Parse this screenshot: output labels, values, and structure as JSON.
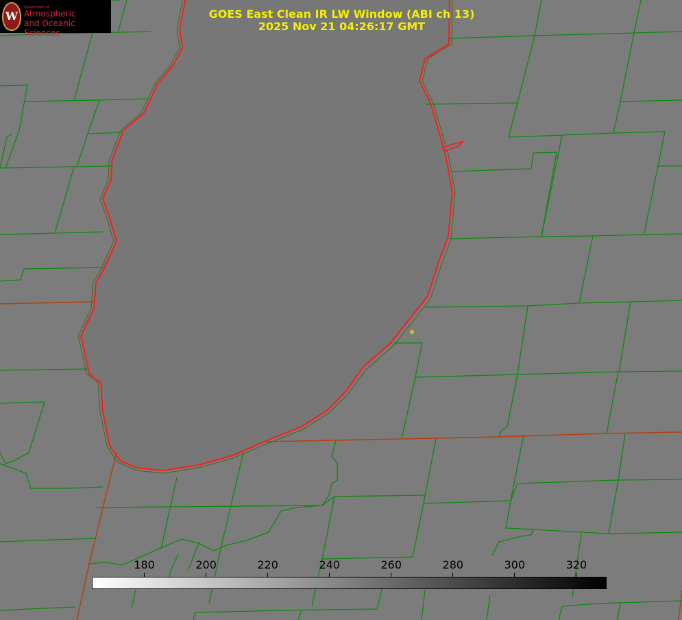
{
  "image": {
    "title_line1": "GOES East Clean IR LW Window (ABI ch 13)",
    "title_line2": "2025 Nov 21 04:26:17 GMT"
  },
  "logo": {
    "dept": "Department of",
    "line1": "Atmospheric",
    "line2": "and Oceanic Sciences",
    "seal_letter": "W"
  },
  "colorbar": {
    "ticks": [
      "180",
      "200",
      "220",
      "240",
      "260",
      "280",
      "300",
      "320"
    ],
    "tick_values": [
      180,
      200,
      220,
      240,
      260,
      280,
      300,
      320
    ],
    "range": [
      163,
      330
    ],
    "gradient": [
      "#ffffff",
      "#000000"
    ]
  },
  "colors": {
    "title": "#f4f000",
    "county_lines": "#0d8a0d",
    "state_lines": "#b34212",
    "lake_shore": "#ff1a1a",
    "marker": "#d4c21a",
    "background": "#7c7c7c",
    "lake": "#777777"
  },
  "features": {
    "lake": "lake-michigan-southern-basin",
    "marker": "station-marker"
  }
}
